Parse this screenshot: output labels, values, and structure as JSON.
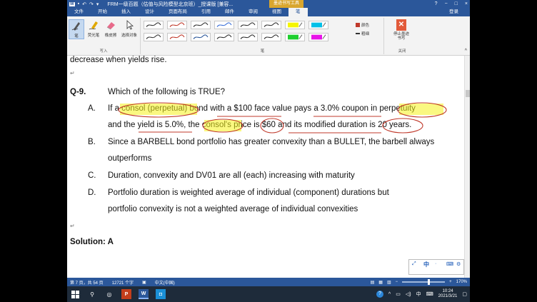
{
  "window": {
    "title": "FRM一级百题（估值与风险模型北京班）_授课版 [兼容...",
    "tools_tab": "墨迹书写工具",
    "help": "?",
    "minimize": "−",
    "restore": "□",
    "close": "×"
  },
  "menu": {
    "tabs": [
      "文件",
      "开始",
      "插入",
      "设计",
      "页面布局",
      "引用",
      "邮件",
      "审阅",
      "视图",
      "笔"
    ],
    "login": "登录"
  },
  "ribbon": {
    "write_group": {
      "label": "写入",
      "buttons": [
        "笔",
        "荧光笔",
        "橡皮擦",
        "选择对象"
      ]
    },
    "pens_group": {
      "label": "笔"
    },
    "color_label": "颜色",
    "weight_label": "粗细",
    "close_group": {
      "label": "关闭",
      "button": "停止墨迹书写"
    },
    "pen_colors": [
      "#333333",
      "#c0392b",
      "#333333",
      "#3a6fd8",
      "#333333",
      "#333333",
      "#f5f500",
      "#00c0e8",
      "#3b3b3b",
      "#c0392b",
      "#2b579a",
      "#333333",
      "#2f2f2f",
      "#333333",
      "#1fcf2f",
      "#e814e8"
    ]
  },
  "document": {
    "prev_text": "decrease when yields rise.",
    "question_num": "Q-9.",
    "question": "Which of the following is TRUE?",
    "options": [
      {
        "letter": "A.",
        "lines": [
          "If a consol (perpetual) bond with a $100 face value pays a 3.0% coupon in perpetuity",
          "and the yield is 5.0%, the consol's price is $60 and its modified duration is 20 years."
        ]
      },
      {
        "letter": "B.",
        "lines": [
          "Since a BARBELL bond portfolio has greater convexity than a BULLET, the barbell always",
          "outperforms"
        ]
      },
      {
        "letter": "C.",
        "lines": [
          "Duration, convexity and DV01 are all (each) increasing with maturity"
        ]
      },
      {
        "letter": "D.",
        "lines": [
          "Portfolio duration is weighted average of individual (component) durations but",
          "portfolio convexity is not a weighted average of individual convexities"
        ]
      }
    ],
    "solution": "Solution: A"
  },
  "statusbar": {
    "page": "第 7 页，共 54 页",
    "words": "12721 个字",
    "language": "中文(中国)",
    "zoom": "170%"
  },
  "taskbar": {
    "time": "10:24",
    "date": "2021/3/21",
    "ime": "中"
  },
  "colors": {
    "accent": "#2b579a",
    "highlight": "#f6f31a",
    "ink": "#c0392b"
  }
}
